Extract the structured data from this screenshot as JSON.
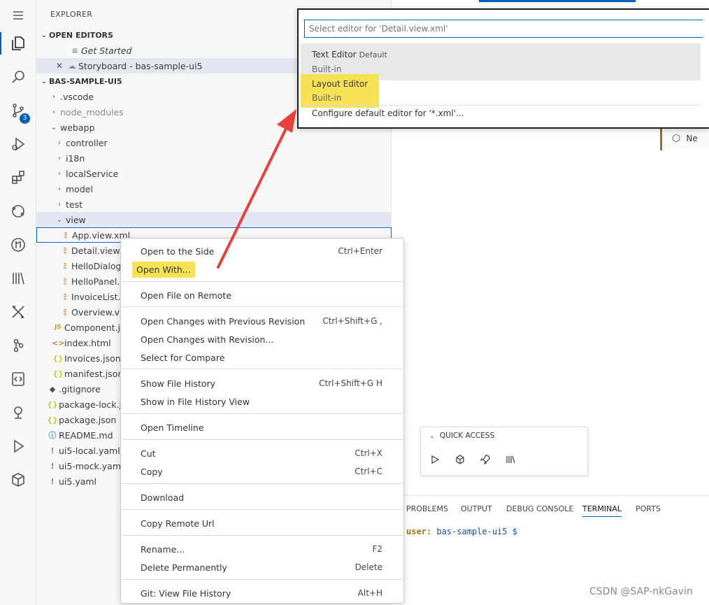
{
  "activity_bar": {
    "icons": [
      "menu-icon",
      "explorer-icon",
      "search-icon",
      "source-control-icon",
      "run-debug-icon",
      "extensions-icon",
      "remote-icon",
      "git-graph-icon",
      "library-icon",
      "tools-icon",
      "commit-icon",
      "code-review-icon",
      "location-icon",
      "run-icon",
      "cube-icon"
    ],
    "source_control_badge": "3"
  },
  "explorer": {
    "title": "EXPLORER",
    "open_editors_header": "OPEN EDITORS",
    "open_editors": [
      "Get Started",
      "Storyboard - bas-sample-ui5"
    ],
    "project_header": "BAS-SAMPLE-UI5",
    "items": [
      ".vscode",
      "node_modules",
      "webapp",
      "controller",
      "i18n",
      "localService",
      "model",
      "test",
      "view",
      "App.view.xml",
      "Detail.view.xml",
      "HelloDialog",
      "HelloPanel.v",
      "InvoiceList.v",
      "Overview.vie",
      "Component.js",
      "index.html",
      "Invoices.json",
      "manifest.json",
      ".gitignore",
      "package-lock.js",
      "package.json",
      "README.md",
      "ui5-local.yaml",
      "ui5-mock.yaml",
      "ui5.yaml"
    ]
  },
  "quick_pick": {
    "placeholder": "Select editor for 'Detail.view.xml'",
    "items": [
      {
        "label": "Text Editor",
        "description": "Default",
        "sub": "Built-in"
      },
      {
        "label": "Layout Editor",
        "sub": "Built-in"
      },
      {
        "label": "Configure default editor for '*.xml'..."
      }
    ]
  },
  "context_menu": {
    "items": [
      {
        "label": "Open to the Side",
        "key": "Ctrl+Enter"
      },
      {
        "label": "Open With...",
        "key": ""
      },
      {
        "label": "Open File on Remote",
        "key": ""
      },
      {
        "label": "Open Changes with Previous Revision",
        "key": "Ctrl+Shift+G ,"
      },
      {
        "label": "Open Changes with Revision...",
        "key": ""
      },
      {
        "label": "Select for Compare",
        "key": ""
      },
      {
        "label": "Show File History",
        "key": "Ctrl+Shift+G H"
      },
      {
        "label": "Show in File History View",
        "key": ""
      },
      {
        "label": "Open Timeline",
        "key": ""
      },
      {
        "label": "Cut",
        "key": "Ctrl+X"
      },
      {
        "label": "Copy",
        "key": "Ctrl+C"
      },
      {
        "label": "Download",
        "key": ""
      },
      {
        "label": "Copy Remote Url",
        "key": ""
      },
      {
        "label": "Rename...",
        "key": "F2"
      },
      {
        "label": "Delete Permanently",
        "key": "Delete"
      },
      {
        "label": "Git: View File History",
        "key": "Alt+H"
      }
    ]
  },
  "quick_access": {
    "title": "QUICK ACCESS",
    "icons": [
      "play-icon",
      "cube-icon",
      "rocket-icon",
      "library-icon"
    ]
  },
  "panel": {
    "tabs": [
      "PROBLEMS",
      "OUTPUT",
      "DEBUG CONSOLE",
      "TERMINAL",
      "PORTS"
    ],
    "active_tab": "TERMINAL",
    "terminal_user": "user:",
    "terminal_path": "bas-sample-ui5 $"
  },
  "fragments": {
    "side_card": "Ne",
    "terminal_text": "term"
  },
  "watermark": "CSDN @SAP-nkGavin",
  "colors": {
    "accent": "#005fb8",
    "highlight": "#f7e254",
    "arrow": "#e8403a"
  }
}
